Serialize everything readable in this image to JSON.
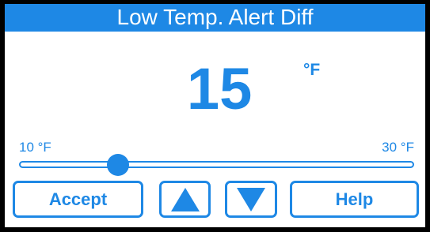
{
  "title": "Low Temp. Alert Diff",
  "setting": {
    "value": "15",
    "unit": "°F"
  },
  "slider": {
    "min_label": "10 °F",
    "max_label": "30 °F",
    "level": 0.25
  },
  "buttons": {
    "accept_label": "Accept",
    "help_label": "Help",
    "up_icon": "up-arrow-icon",
    "down_icon": "down-arrow-icon"
  },
  "colors": {
    "accent": "#1e88e5",
    "background": "#ffffff",
    "frame": "#000000"
  }
}
